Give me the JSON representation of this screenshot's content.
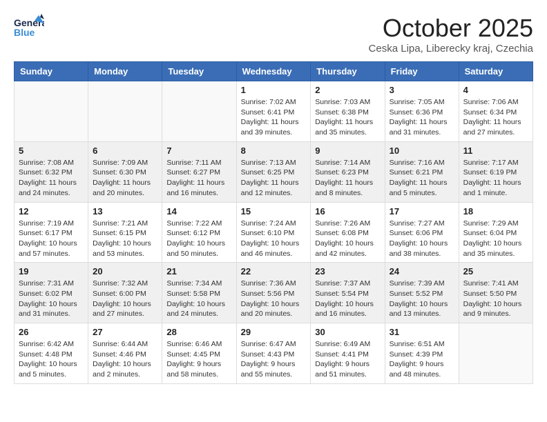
{
  "header": {
    "logo_general": "General",
    "logo_blue": "Blue",
    "month_title": "October 2025",
    "location": "Ceska Lipa, Liberecky kraj, Czechia"
  },
  "days_of_week": [
    "Sunday",
    "Monday",
    "Tuesday",
    "Wednesday",
    "Thursday",
    "Friday",
    "Saturday"
  ],
  "weeks": [
    [
      {
        "day": "",
        "info": ""
      },
      {
        "day": "",
        "info": ""
      },
      {
        "day": "",
        "info": ""
      },
      {
        "day": "1",
        "info": "Sunrise: 7:02 AM\nSunset: 6:41 PM\nDaylight: 11 hours\nand 39 minutes."
      },
      {
        "day": "2",
        "info": "Sunrise: 7:03 AM\nSunset: 6:38 PM\nDaylight: 11 hours\nand 35 minutes."
      },
      {
        "day": "3",
        "info": "Sunrise: 7:05 AM\nSunset: 6:36 PM\nDaylight: 11 hours\nand 31 minutes."
      },
      {
        "day": "4",
        "info": "Sunrise: 7:06 AM\nSunset: 6:34 PM\nDaylight: 11 hours\nand 27 minutes."
      }
    ],
    [
      {
        "day": "5",
        "info": "Sunrise: 7:08 AM\nSunset: 6:32 PM\nDaylight: 11 hours\nand 24 minutes."
      },
      {
        "day": "6",
        "info": "Sunrise: 7:09 AM\nSunset: 6:30 PM\nDaylight: 11 hours\nand 20 minutes."
      },
      {
        "day": "7",
        "info": "Sunrise: 7:11 AM\nSunset: 6:27 PM\nDaylight: 11 hours\nand 16 minutes."
      },
      {
        "day": "8",
        "info": "Sunrise: 7:13 AM\nSunset: 6:25 PM\nDaylight: 11 hours\nand 12 minutes."
      },
      {
        "day": "9",
        "info": "Sunrise: 7:14 AM\nSunset: 6:23 PM\nDaylight: 11 hours\nand 8 minutes."
      },
      {
        "day": "10",
        "info": "Sunrise: 7:16 AM\nSunset: 6:21 PM\nDaylight: 11 hours\nand 5 minutes."
      },
      {
        "day": "11",
        "info": "Sunrise: 7:17 AM\nSunset: 6:19 PM\nDaylight: 11 hours\nand 1 minute."
      }
    ],
    [
      {
        "day": "12",
        "info": "Sunrise: 7:19 AM\nSunset: 6:17 PM\nDaylight: 10 hours\nand 57 minutes."
      },
      {
        "day": "13",
        "info": "Sunrise: 7:21 AM\nSunset: 6:15 PM\nDaylight: 10 hours\nand 53 minutes."
      },
      {
        "day": "14",
        "info": "Sunrise: 7:22 AM\nSunset: 6:12 PM\nDaylight: 10 hours\nand 50 minutes."
      },
      {
        "day": "15",
        "info": "Sunrise: 7:24 AM\nSunset: 6:10 PM\nDaylight: 10 hours\nand 46 minutes."
      },
      {
        "day": "16",
        "info": "Sunrise: 7:26 AM\nSunset: 6:08 PM\nDaylight: 10 hours\nand 42 minutes."
      },
      {
        "day": "17",
        "info": "Sunrise: 7:27 AM\nSunset: 6:06 PM\nDaylight: 10 hours\nand 38 minutes."
      },
      {
        "day": "18",
        "info": "Sunrise: 7:29 AM\nSunset: 6:04 PM\nDaylight: 10 hours\nand 35 minutes."
      }
    ],
    [
      {
        "day": "19",
        "info": "Sunrise: 7:31 AM\nSunset: 6:02 PM\nDaylight: 10 hours\nand 31 minutes."
      },
      {
        "day": "20",
        "info": "Sunrise: 7:32 AM\nSunset: 6:00 PM\nDaylight: 10 hours\nand 27 minutes."
      },
      {
        "day": "21",
        "info": "Sunrise: 7:34 AM\nSunset: 5:58 PM\nDaylight: 10 hours\nand 24 minutes."
      },
      {
        "day": "22",
        "info": "Sunrise: 7:36 AM\nSunset: 5:56 PM\nDaylight: 10 hours\nand 20 minutes."
      },
      {
        "day": "23",
        "info": "Sunrise: 7:37 AM\nSunset: 5:54 PM\nDaylight: 10 hours\nand 16 minutes."
      },
      {
        "day": "24",
        "info": "Sunrise: 7:39 AM\nSunset: 5:52 PM\nDaylight: 10 hours\nand 13 minutes."
      },
      {
        "day": "25",
        "info": "Sunrise: 7:41 AM\nSunset: 5:50 PM\nDaylight: 10 hours\nand 9 minutes."
      }
    ],
    [
      {
        "day": "26",
        "info": "Sunrise: 6:42 AM\nSunset: 4:48 PM\nDaylight: 10 hours\nand 5 minutes."
      },
      {
        "day": "27",
        "info": "Sunrise: 6:44 AM\nSunset: 4:46 PM\nDaylight: 10 hours\nand 2 minutes."
      },
      {
        "day": "28",
        "info": "Sunrise: 6:46 AM\nSunset: 4:45 PM\nDaylight: 9 hours\nand 58 minutes."
      },
      {
        "day": "29",
        "info": "Sunrise: 6:47 AM\nSunset: 4:43 PM\nDaylight: 9 hours\nand 55 minutes."
      },
      {
        "day": "30",
        "info": "Sunrise: 6:49 AM\nSunset: 4:41 PM\nDaylight: 9 hours\nand 51 minutes."
      },
      {
        "day": "31",
        "info": "Sunrise: 6:51 AM\nSunset: 4:39 PM\nDaylight: 9 hours\nand 48 minutes."
      },
      {
        "day": "",
        "info": ""
      }
    ]
  ]
}
